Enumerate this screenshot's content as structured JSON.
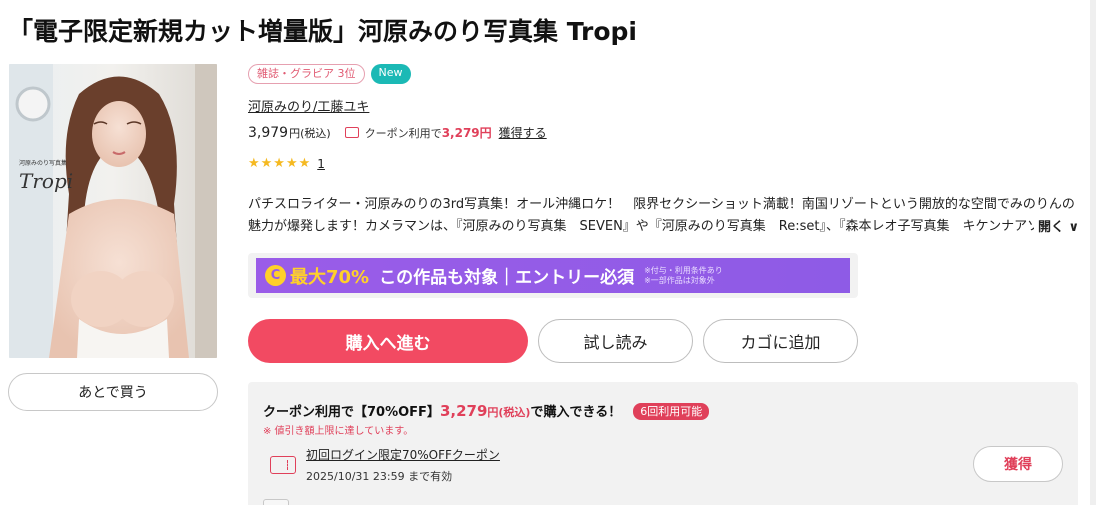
{
  "product": {
    "title": "「電子限定新規カット増量版」河原みのり写真集 Tropi",
    "cover": {
      "sub_text": "河原みのり写真集",
      "logo_text": "Tropi"
    },
    "later_button": "あとで買う",
    "badges": {
      "rank": "雑誌・グラビア 3位",
      "new": "New"
    },
    "authors": "河原みのり/工藤ユキ",
    "price": {
      "value": "3,979",
      "unit": "円(税込)",
      "coupon_label": "クーポン利用で",
      "coupon_price": "3,279円",
      "obtain_link": "獲得する"
    },
    "rating": {
      "stars": "★★★★★",
      "count": "1"
    },
    "description": "パチスロライター・河原みのりの3rd写真集！オール沖縄ロケ！　限界セクシーショット満載！南国リゾートという開放的な空間でみのりんの魅力が爆発します！カメラマンは、『河原みのり写真集　SEVEN』や『河原みのり写真集　Re:set』、『森本レオ子写真集　キケンナアソビ』",
    "description_toggle": "開く ∨",
    "banner": {
      "coin": "C",
      "max_text": "最大70%",
      "main_text": "この作品も対象｜エントリー必須",
      "note1": "※付与・利用条件あり",
      "note2": "※一部作品は対象外"
    },
    "actions": {
      "buy": "購入へ進む",
      "trial": "試し読み",
      "cart": "カゴに追加"
    }
  },
  "coupon_panel": {
    "headline_prefix": "クーポン利用で【70%OFF】",
    "headline_price": "3,279",
    "headline_unit": "円(税込)",
    "headline_suffix": "で購入できる！",
    "uses_badge": "6回利用可能",
    "limit_note": "※ 値引き額上限に達しています。",
    "coupon_name": "初回ログイン限定70%OFFクーポン",
    "expire": "2025/10/31 23:59 まで有効",
    "get_button": "獲得"
  },
  "colors": {
    "accent": "#f24a62",
    "coupon_red": "#e0405a",
    "new_badge": "#1bb9b5",
    "banner_purple": "#9a5ce8",
    "banner_yellow": "#ffd02a",
    "star": "#f5b921"
  }
}
